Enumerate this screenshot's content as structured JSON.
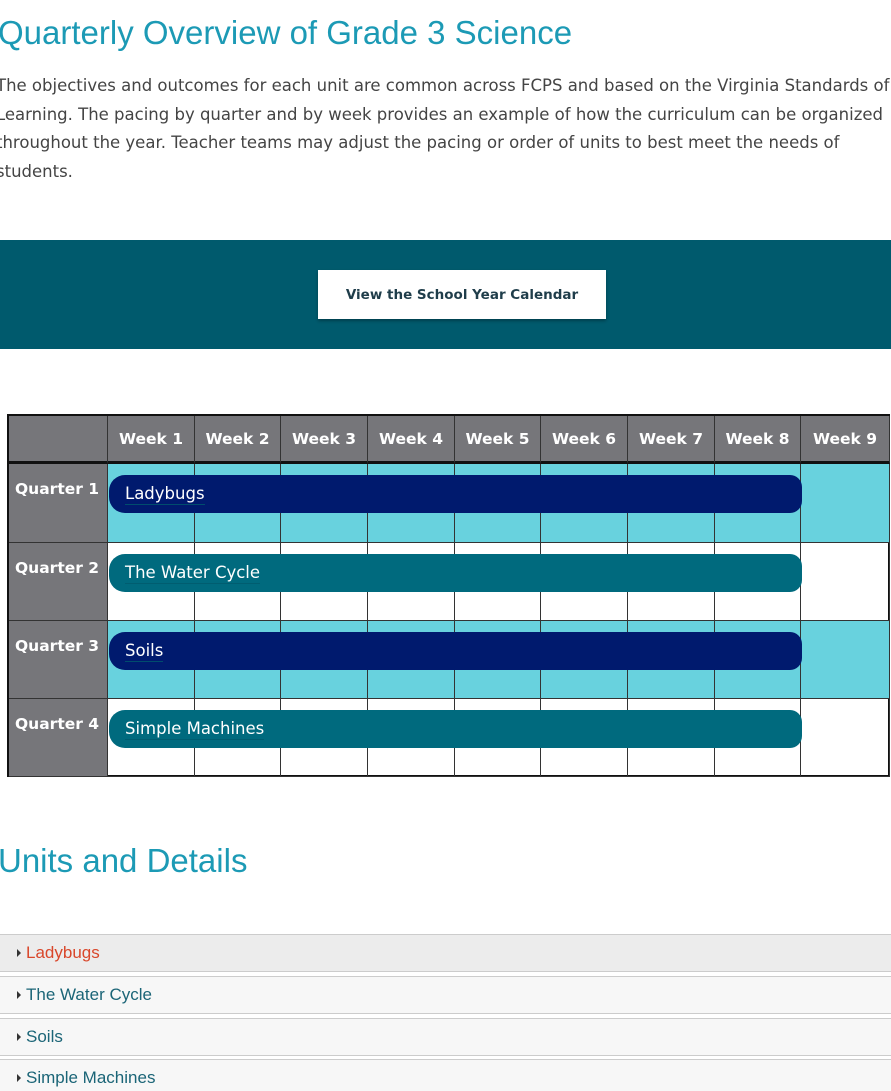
{
  "title": "Quarterly Overview of Grade 3 Science",
  "intro": "The objectives and outcomes for each unit are common across FCPS and based on the Virginia Standards of Learning. The pacing by quarter and by week provides an example of how the curriculum can be organized throughout the year. Teacher teams may adjust the pacing or order of units to best meet the needs of students.",
  "calendar_button": "View the School Year Calendar",
  "weeks": [
    "Week 1",
    "Week 2",
    "Week 3",
    "Week 4",
    "Week 5",
    "Week 6",
    "Week 7",
    "Week 8",
    "Week 9"
  ],
  "quarters": [
    {
      "label": "Quarter 1",
      "unit": "Ladybugs",
      "weeks_spanned": 8,
      "highlight": true
    },
    {
      "label": "Quarter 2",
      "unit": "The Water Cycle",
      "weeks_spanned": 8,
      "highlight": false
    },
    {
      "label": "Quarter 3",
      "unit": "Soils",
      "weeks_spanned": 8,
      "highlight": true
    },
    {
      "label": "Quarter 4",
      "unit": "Simple Machines",
      "weeks_spanned": 8,
      "highlight": false
    }
  ],
  "units_heading": "Units and Details",
  "units": [
    "Ladybugs",
    "The Water Cycle",
    "Soils",
    "Simple Machines"
  ],
  "colors": {
    "heading": "#1c9ab5",
    "band": "#005a6d",
    "highlight": "#68d2de",
    "bar_dark": "#001a6e",
    "bar_teal": "#006a7e",
    "active_link": "#d9472b"
  }
}
